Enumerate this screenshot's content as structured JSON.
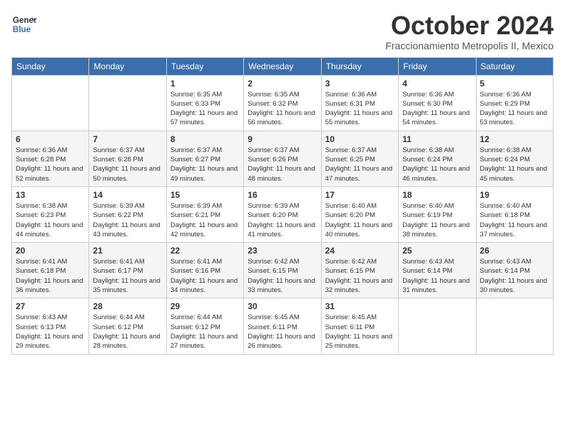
{
  "header": {
    "logo_line1": "General",
    "logo_line2": "Blue",
    "month": "October 2024",
    "location": "Fraccionamiento Metropolis II, Mexico"
  },
  "days_of_week": [
    "Sunday",
    "Monday",
    "Tuesday",
    "Wednesday",
    "Thursday",
    "Friday",
    "Saturday"
  ],
  "weeks": [
    [
      {
        "day": "",
        "info": ""
      },
      {
        "day": "",
        "info": ""
      },
      {
        "day": "1",
        "info": "Sunrise: 6:35 AM\nSunset: 6:33 PM\nDaylight: 11 hours and 57 minutes."
      },
      {
        "day": "2",
        "info": "Sunrise: 6:35 AM\nSunset: 6:32 PM\nDaylight: 11 hours and 56 minutes."
      },
      {
        "day": "3",
        "info": "Sunrise: 6:36 AM\nSunset: 6:31 PM\nDaylight: 11 hours and 55 minutes."
      },
      {
        "day": "4",
        "info": "Sunrise: 6:36 AM\nSunset: 6:30 PM\nDaylight: 11 hours and 54 minutes."
      },
      {
        "day": "5",
        "info": "Sunrise: 6:36 AM\nSunset: 6:29 PM\nDaylight: 11 hours and 53 minutes."
      }
    ],
    [
      {
        "day": "6",
        "info": "Sunrise: 6:36 AM\nSunset: 6:28 PM\nDaylight: 11 hours and 52 minutes."
      },
      {
        "day": "7",
        "info": "Sunrise: 6:37 AM\nSunset: 6:28 PM\nDaylight: 11 hours and 50 minutes."
      },
      {
        "day": "8",
        "info": "Sunrise: 6:37 AM\nSunset: 6:27 PM\nDaylight: 11 hours and 49 minutes."
      },
      {
        "day": "9",
        "info": "Sunrise: 6:37 AM\nSunset: 6:26 PM\nDaylight: 11 hours and 48 minutes."
      },
      {
        "day": "10",
        "info": "Sunrise: 6:37 AM\nSunset: 6:25 PM\nDaylight: 11 hours and 47 minutes."
      },
      {
        "day": "11",
        "info": "Sunrise: 6:38 AM\nSunset: 6:24 PM\nDaylight: 11 hours and 46 minutes."
      },
      {
        "day": "12",
        "info": "Sunrise: 6:38 AM\nSunset: 6:24 PM\nDaylight: 11 hours and 45 minutes."
      }
    ],
    [
      {
        "day": "13",
        "info": "Sunrise: 6:38 AM\nSunset: 6:23 PM\nDaylight: 11 hours and 44 minutes."
      },
      {
        "day": "14",
        "info": "Sunrise: 6:39 AM\nSunset: 6:22 PM\nDaylight: 11 hours and 43 minutes."
      },
      {
        "day": "15",
        "info": "Sunrise: 6:39 AM\nSunset: 6:21 PM\nDaylight: 11 hours and 42 minutes."
      },
      {
        "day": "16",
        "info": "Sunrise: 6:39 AM\nSunset: 6:20 PM\nDaylight: 11 hours and 41 minutes."
      },
      {
        "day": "17",
        "info": "Sunrise: 6:40 AM\nSunset: 6:20 PM\nDaylight: 11 hours and 40 minutes."
      },
      {
        "day": "18",
        "info": "Sunrise: 6:40 AM\nSunset: 6:19 PM\nDaylight: 11 hours and 38 minutes."
      },
      {
        "day": "19",
        "info": "Sunrise: 6:40 AM\nSunset: 6:18 PM\nDaylight: 11 hours and 37 minutes."
      }
    ],
    [
      {
        "day": "20",
        "info": "Sunrise: 6:41 AM\nSunset: 6:18 PM\nDaylight: 11 hours and 36 minutes."
      },
      {
        "day": "21",
        "info": "Sunrise: 6:41 AM\nSunset: 6:17 PM\nDaylight: 11 hours and 35 minutes."
      },
      {
        "day": "22",
        "info": "Sunrise: 6:41 AM\nSunset: 6:16 PM\nDaylight: 11 hours and 34 minutes."
      },
      {
        "day": "23",
        "info": "Sunrise: 6:42 AM\nSunset: 6:15 PM\nDaylight: 11 hours and 33 minutes."
      },
      {
        "day": "24",
        "info": "Sunrise: 6:42 AM\nSunset: 6:15 PM\nDaylight: 11 hours and 32 minutes."
      },
      {
        "day": "25",
        "info": "Sunrise: 6:43 AM\nSunset: 6:14 PM\nDaylight: 11 hours and 31 minutes."
      },
      {
        "day": "26",
        "info": "Sunrise: 6:43 AM\nSunset: 6:14 PM\nDaylight: 11 hours and 30 minutes."
      }
    ],
    [
      {
        "day": "27",
        "info": "Sunrise: 6:43 AM\nSunset: 6:13 PM\nDaylight: 11 hours and 29 minutes."
      },
      {
        "day": "28",
        "info": "Sunrise: 6:44 AM\nSunset: 6:12 PM\nDaylight: 11 hours and 28 minutes."
      },
      {
        "day": "29",
        "info": "Sunrise: 6:44 AM\nSunset: 6:12 PM\nDaylight: 11 hours and 27 minutes."
      },
      {
        "day": "30",
        "info": "Sunrise: 6:45 AM\nSunset: 6:11 PM\nDaylight: 11 hours and 26 minutes."
      },
      {
        "day": "31",
        "info": "Sunrise: 6:45 AM\nSunset: 6:11 PM\nDaylight: 11 hours and 25 minutes."
      },
      {
        "day": "",
        "info": ""
      },
      {
        "day": "",
        "info": ""
      }
    ]
  ]
}
